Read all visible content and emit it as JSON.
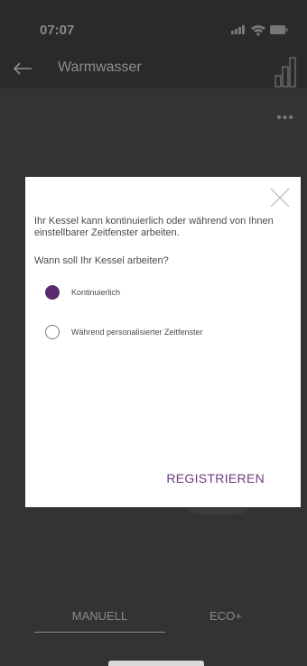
{
  "status_bar": {
    "time": "07:07",
    "icons": [
      "signal-icon",
      "wifi-icon",
      "battery-icon"
    ]
  },
  "app_bar": {
    "title": "Warmwasser",
    "back_icon": "arrow-left-icon",
    "right_icon": "signal-strength-icon"
  },
  "more_menu": {
    "label": "•••"
  },
  "dialog": {
    "message": "Ihr Kessel kann kontinuierlich oder während von Ihnen einstellbarer Zeitfenster arbeiten.",
    "question": "Wann soll Ihr Kessel arbeiten?",
    "options": [
      {
        "label": "Kontinuierlich",
        "selected": true
      },
      {
        "label": "Während personalisierter Zeitfenster",
        "selected": false
      }
    ],
    "confirm_label": "REGISTRIEREN",
    "close_icon": "close-icon"
  },
  "tabs": [
    {
      "label": "MANUELL",
      "active": true
    },
    {
      "label": "ECO+",
      "active": false
    }
  ],
  "colors": {
    "accent": "#5b2a6e",
    "button_text": "#6d3a7e",
    "overlay": "#333333",
    "dialog_bg": "#ffffff"
  }
}
